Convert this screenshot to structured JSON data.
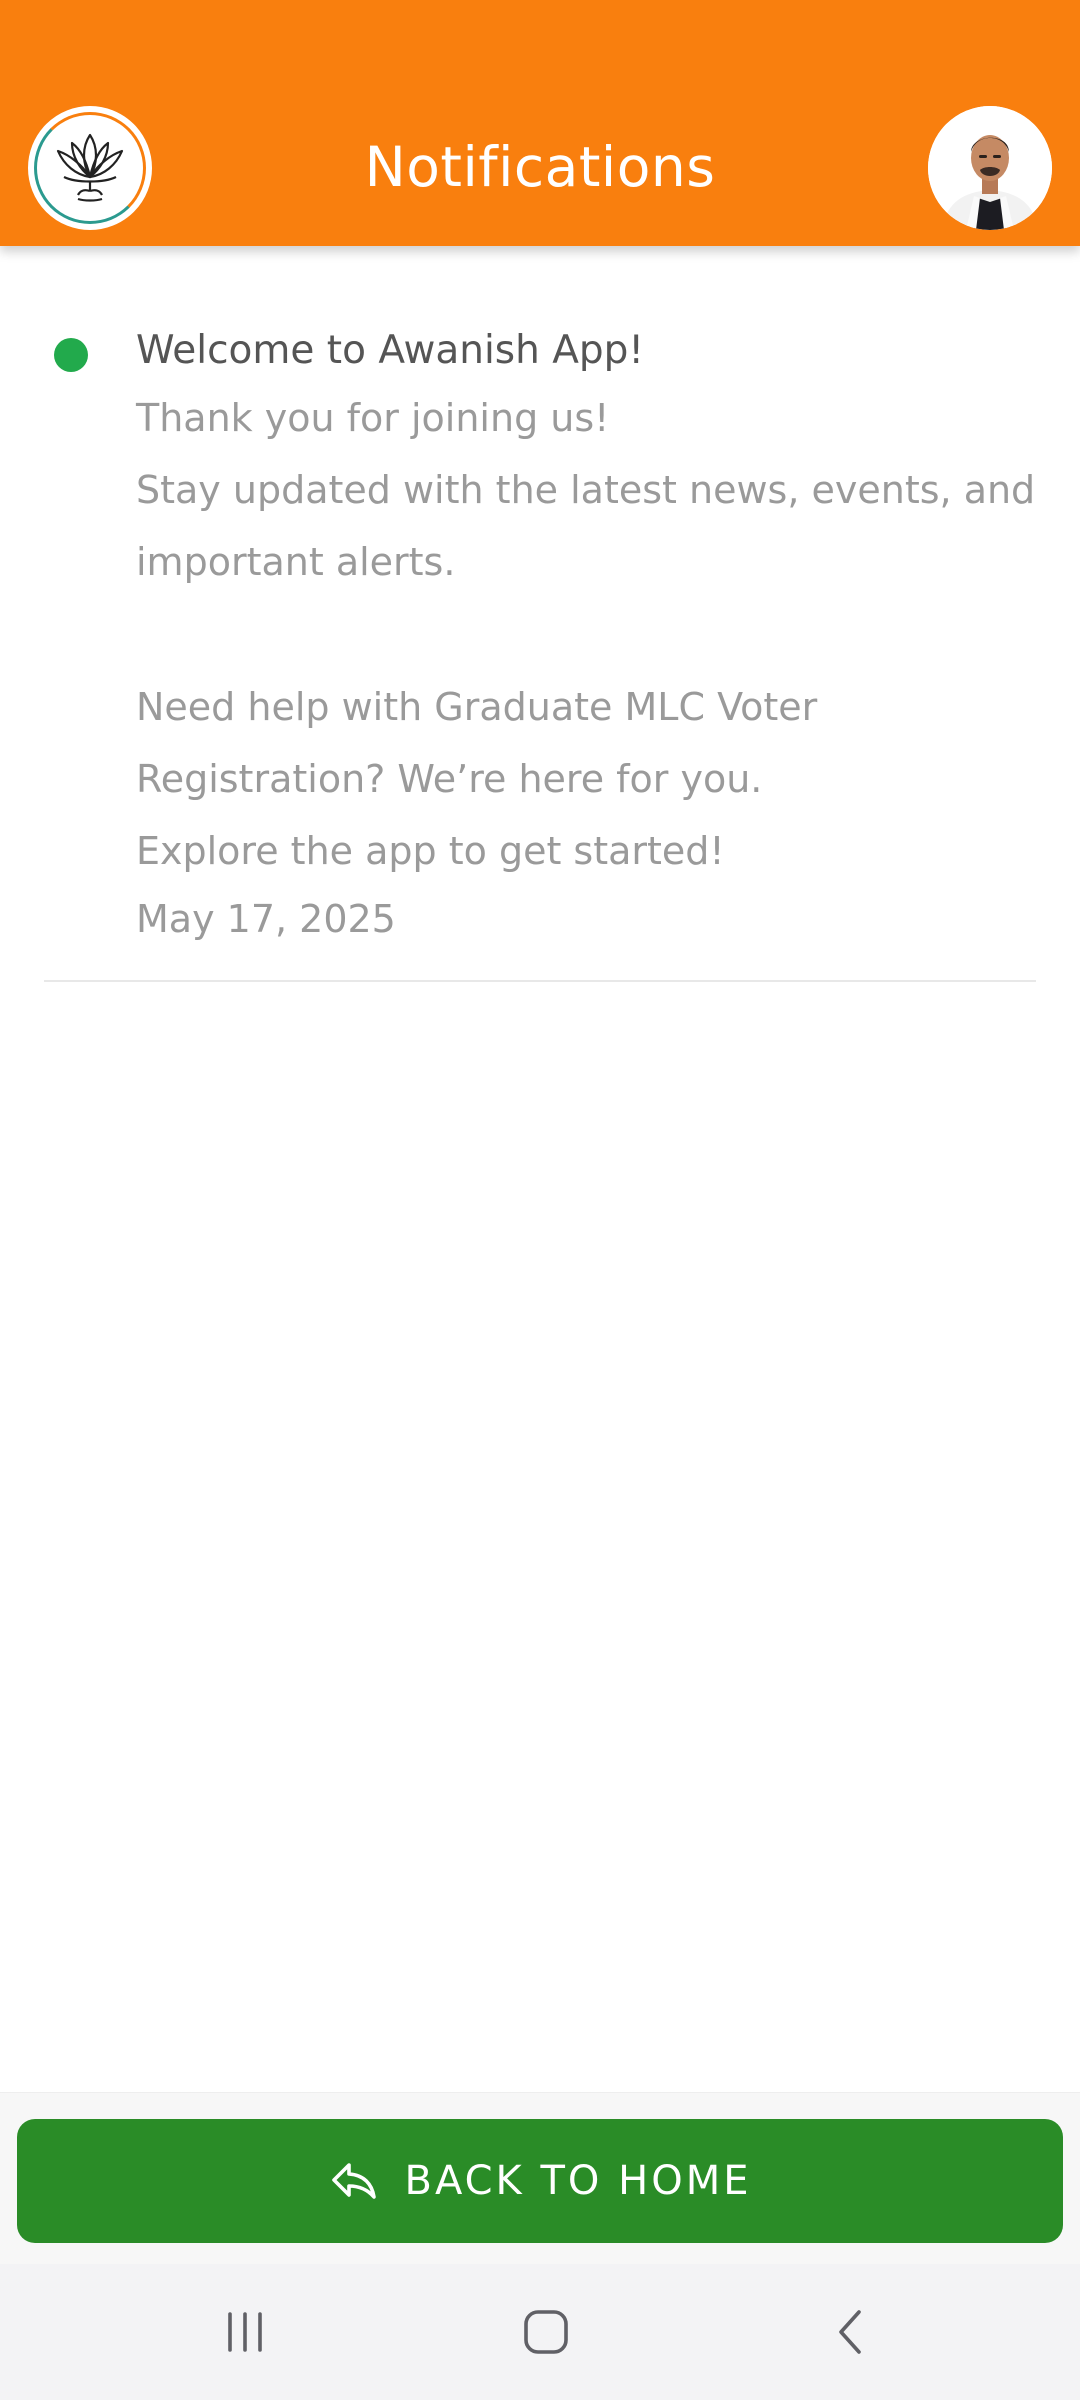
{
  "header": {
    "title": "Notifications",
    "logo_icon": "lotus-logo-icon",
    "profile_icon": "profile-avatar"
  },
  "notifications": [
    {
      "unread": true,
      "status_color": "#22aa4c",
      "title": "Welcome to Awanish App!",
      "lines": [
        "Thank you for joining us!",
        "Stay updated with the latest news, events, and",
        "important alerts.",
        "",
        "Need help with Graduate MLC Voter",
        "Registration? We’re here for you.",
        "Explore the app to get started!"
      ],
      "date": "May 17, 2025"
    }
  ],
  "footer": {
    "back_button_label": "BACK TO HOME",
    "back_button_icon": "reply-arrow-icon",
    "button_color": "#2a8c27"
  },
  "system_nav": {
    "recents_icon": "recents-icon",
    "home_icon": "home-icon",
    "back_icon": "back-chevron-icon"
  },
  "colors": {
    "header_bg": "#f97f0e",
    "accent_green": "#2a8c27"
  }
}
